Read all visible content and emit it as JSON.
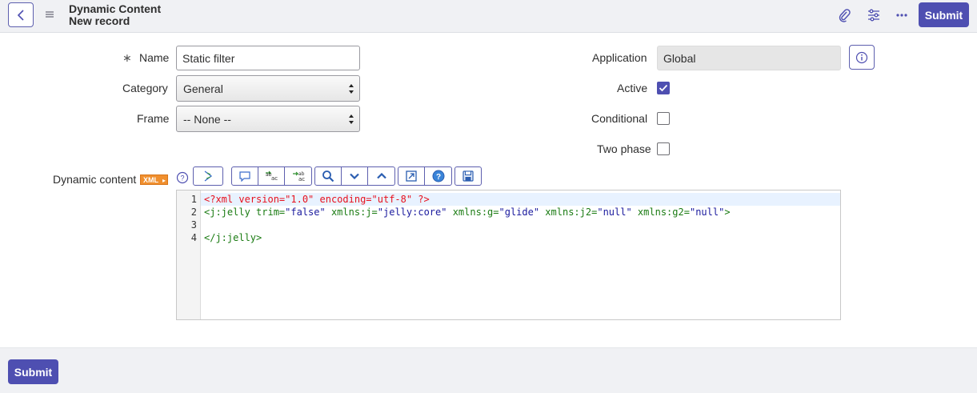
{
  "header": {
    "title_line1": "Dynamic Content",
    "title_line2": "New record",
    "submit_label": "Submit",
    "icons": [
      "back-icon",
      "hamburger-menu-icon",
      "attachment-icon",
      "personalize-form-icon",
      "more-options-icon"
    ]
  },
  "form": {
    "name": {
      "label": "Name",
      "value": "Static filter",
      "required_mark": "∗"
    },
    "category": {
      "label": "Category",
      "value": "General"
    },
    "frame": {
      "label": "Frame",
      "value": "-- None --"
    },
    "application": {
      "label": "Application",
      "value": "Global"
    },
    "active": {
      "label": "Active",
      "checked": true
    },
    "conditional": {
      "label": "Conditional",
      "checked": false
    },
    "two_phase": {
      "label": "Two phase",
      "checked": false
    },
    "dynamic_content": {
      "label": "Dynamic content",
      "badge": "XML"
    }
  },
  "toolbar": {
    "groups": [
      [
        "toggle-syntax-icon"
      ],
      [
        "comment-icon",
        "replace-icon",
        "replace-all-icon"
      ],
      [
        "search-icon",
        "next-icon",
        "previous-icon"
      ],
      [
        "fullscreen-icon",
        "help-icon"
      ],
      [
        "save-icon"
      ]
    ]
  },
  "editor": {
    "lines": [
      {
        "num": "1",
        "text": "<?xml version=\"1.0\" encoding=\"utf-8\" ?>"
      },
      {
        "num": "2",
        "text": "<j:jelly trim=\"false\" xmlns:j=\"jelly:core\" xmlns:g=\"glide\" xmlns:j2=\"null\" xmlns:g2=\"null\">"
      },
      {
        "num": "3",
        "text": ""
      },
      {
        "num": "4",
        "text": "</j:jelly>"
      }
    ],
    "colors": {
      "pi": "#e8101c",
      "tag": "#1a7b12",
      "attr": "#1a1a9e",
      "value": "#1a1a9e"
    }
  },
  "footer": {
    "submit_label": "Submit"
  },
  "colors": {
    "accent": "#4e4fb1",
    "header_bg": "#f0f1f4"
  }
}
